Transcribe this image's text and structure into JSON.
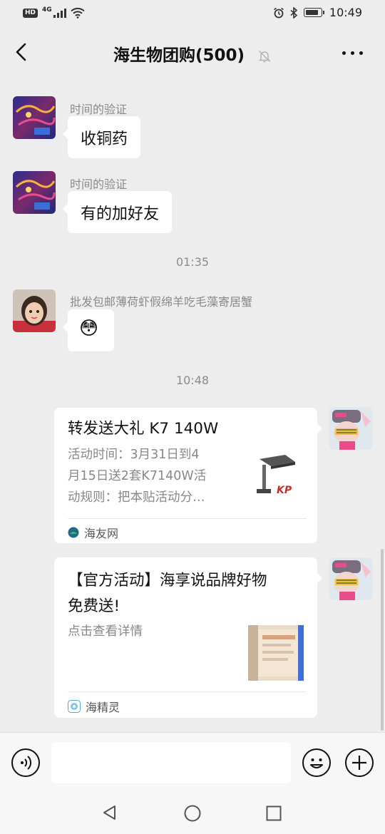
{
  "status_bar": {
    "network": "4G",
    "hd_label": "HD",
    "time": "10:49"
  },
  "nav": {
    "title": "海生物团购(500)",
    "muted": true
  },
  "messages": [
    {
      "sender": "时间的验证",
      "text": "收铜药"
    },
    {
      "sender": "时间的验证",
      "text": "有的加好友"
    },
    {
      "sender": "批发包邮薄荷虾假绵羊吃毛藻寄居蟹",
      "text": "😳"
    }
  ],
  "timestamps": [
    "01:35",
    "10:48"
  ],
  "cards": [
    {
      "title": "转发送大礼 K7 140W",
      "desc_lines": [
        "活动时间：3月31日到4",
        "月15日送2套K7140W活",
        "动规则：把本贴活动分…"
      ],
      "source": "海友网",
      "thumb_label": "KP"
    },
    {
      "title_lines": [
        "【官方活动】海享说品牌好物",
        "免费送!"
      ],
      "desc": "点击查看详情",
      "source": "海精灵"
    }
  ],
  "colors": {
    "background": "#ededed",
    "bubble": "#ffffff",
    "muted_text": "#8a8a8a"
  }
}
